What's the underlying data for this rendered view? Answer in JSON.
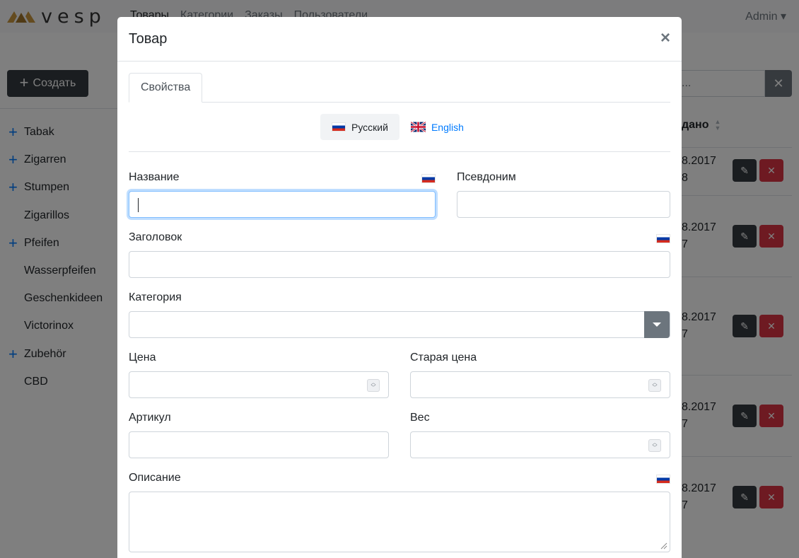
{
  "navbar": {
    "logo_text": "vesp",
    "links": [
      {
        "label": "Товары",
        "active": true
      },
      {
        "label": "Категории",
        "active": false
      },
      {
        "label": "Заказы",
        "active": false
      },
      {
        "label": "Пользователи",
        "active": false
      }
    ],
    "user_menu": "Admin ▾"
  },
  "sidebar": {
    "create_label": "Создать",
    "categories": [
      {
        "label": "Tabak",
        "expandable": true
      },
      {
        "label": "Zigarren",
        "expandable": true
      },
      {
        "label": "Stumpen",
        "expandable": true
      },
      {
        "label": "Zigarillos",
        "expandable": false
      },
      {
        "label": "Pfeifen",
        "expandable": true
      },
      {
        "label": "Wasserpfeifen",
        "expandable": false
      },
      {
        "label": "Geschenkideen",
        "expandable": false
      },
      {
        "label": "Victorinox",
        "expandable": false
      },
      {
        "label": "Zubehör",
        "expandable": true
      },
      {
        "label": "CBD",
        "expandable": false
      }
    ]
  },
  "table": {
    "search_placeholder": "...",
    "created_header": "дано",
    "rows": [
      {
        "date": "8.2017",
        "time": "8"
      },
      {
        "date": "8.2017",
        "time": "7"
      },
      {
        "date": "8.2017",
        "time": "7"
      },
      {
        "date": "8.2017",
        "time": "7"
      },
      {
        "date": "8.2017",
        "time": "7"
      }
    ]
  },
  "modal": {
    "title": "Товар",
    "close_symbol": "×",
    "tab_properties": "Свойства",
    "lang_ru": "Русский",
    "lang_en": "English",
    "labels": {
      "name": "Название",
      "alias": "Псевдоним",
      "heading": "Заголовок",
      "category": "Категория",
      "price": "Цена",
      "old_price": "Старая цена",
      "sku": "Артикул",
      "weight": "Вес",
      "description": "Описание"
    },
    "values": {
      "name": "",
      "alias": "",
      "heading": "",
      "category": "",
      "price": "",
      "old_price": "",
      "sku": "",
      "weight": "",
      "description": ""
    }
  },
  "colors": {
    "primary": "#007bff",
    "dark": "#343a40",
    "danger": "#dc3545",
    "secondary": "#6c757d",
    "logo_gold": "#c8963e"
  }
}
